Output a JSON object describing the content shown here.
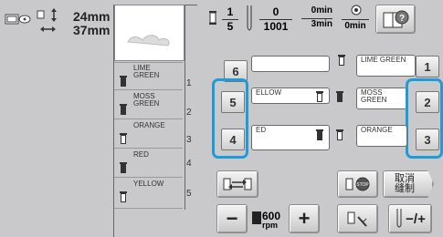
{
  "size": {
    "height_value": "24mm",
    "width_value": "37mm"
  },
  "counters": {
    "stitch_current": "1",
    "stitch_total": "5",
    "color_current": "0",
    "color_total": "1001",
    "time_current": "0min",
    "time_total": "3min",
    "bobbin_value": "0min"
  },
  "thread_list": [
    {
      "number": "1",
      "color": "LIME GREEN"
    },
    {
      "number": "2",
      "color": "MOSS GREEN"
    },
    {
      "number": "3",
      "color": "ORANGE"
    },
    {
      "number": "4",
      "color": "RED"
    },
    {
      "number": "5",
      "color": "YELLOW"
    }
  ],
  "spool_left_numbers": [
    "6",
    "5",
    "4"
  ],
  "spool_right_numbers": [
    "1",
    "2",
    "3"
  ],
  "spool_left_labels": [
    "",
    "ELLOW",
    "ED"
  ],
  "spool_right_labels": [
    "LIME GREEN",
    "MOSS GREEN",
    "ORANGE"
  ],
  "bottom": {
    "cancel_label": "取消\n缝制",
    "speed_value": "600",
    "speed_unit": "rpm",
    "minus_label": "−",
    "plus_label": "+",
    "needle_pm_label": "−/+"
  },
  "colors": {
    "accent": "#1f9bd8",
    "panel": "#c9c9cb"
  },
  "icons": [
    "embroidery-frame-icon",
    "size-arrows-icon",
    "help-book-icon",
    "presser-foot-icon",
    "stop-button-icon",
    "bobbin-swap-icon",
    "needle-icon",
    "thread-trim-icon"
  ]
}
